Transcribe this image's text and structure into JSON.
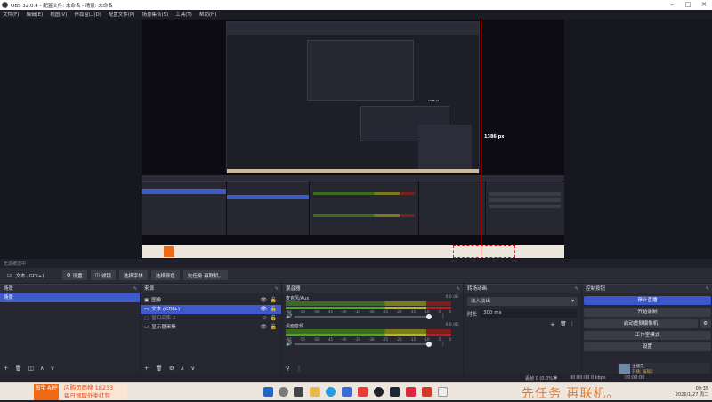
{
  "window": {
    "title": "OBS 32.0.4 - 配置文件: 未命名 - 场景: 未命名"
  },
  "menu": [
    "文件(F)",
    "编辑(E)",
    "视图(V)",
    "停靠窗口(D)",
    "配置文件(P)",
    "场景集合(S)",
    "工具(T)",
    "帮助(H)"
  ],
  "preview": {
    "measure_label": "1386 px",
    "inner_measure_label": "1386 px"
  },
  "status_line": "无源被选中",
  "source_toolbar": {
    "source_name": "文本 (GDI+)",
    "settings": "设置",
    "filters": "滤镜",
    "select_font": "选择字体",
    "select_color": "选择颜色",
    "text_value": "先任务 再联机。"
  },
  "scenes": {
    "title": "场景",
    "items": [
      "场景"
    ]
  },
  "sources": {
    "title": "来源",
    "items": [
      "图像",
      "文本 (GDI+)",
      "窗口采集 2",
      "显示器采集"
    ]
  },
  "mixer": {
    "title": "混音器",
    "channels": [
      {
        "name": "麦克风/Aux",
        "db": "0.0 dB"
      },
      {
        "name": "桌面音频",
        "db": "0.0 dB"
      }
    ],
    "ticks": [
      "-60",
      "-55",
      "-50",
      "-45",
      "-40",
      "-35",
      "-30",
      "-25",
      "-20",
      "-15",
      "-10",
      "-5",
      "0"
    ]
  },
  "transitions": {
    "title": "转场动画",
    "type": "淡入淡出",
    "duration_label": "时长",
    "duration_value": "300 ms"
  },
  "controls": {
    "title": "控制按钮",
    "buttons": [
      "停止直播",
      "开始录制",
      "启动虚拟摄像机",
      "工作室模式",
      "设置"
    ]
  },
  "statusbar": {
    "frames": "丢帧 0 (0.0%)",
    "rec_time": "00:00:00",
    "kbps": "0 kbps",
    "stream_time": "00:00:00"
  },
  "taskbar": {
    "ad_brand": "淘宝 APP",
    "ad_line1": "闪购页面搜 18233",
    "ad_line2": "每日领取外卖红包",
    "slogan": "先任务 再联机。",
    "tray_time": "09:35",
    "tray_date": "2026/1/27 周二"
  },
  "notif": {
    "name": "主播先",
    "status": "开播: 编辑2"
  }
}
